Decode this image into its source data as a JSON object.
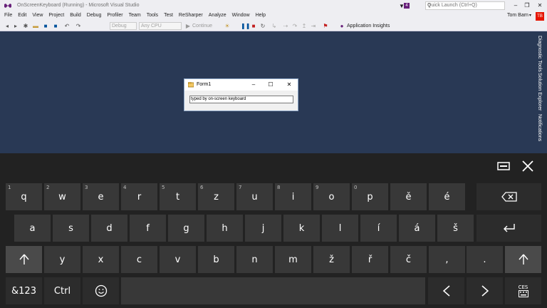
{
  "window": {
    "title": "OnScreenKeyboard (Running) - Microsoft Visual Studio",
    "notification_count": "4",
    "quick_launch_placeholder": "Quick Launch (Ctrl+Q)",
    "minimize": "–",
    "restore": "❐",
    "close": "✕"
  },
  "menu": [
    "File",
    "Edit",
    "View",
    "Project",
    "Build",
    "Debug",
    "Profiler",
    "Team",
    "Tools",
    "Test",
    "ReSharper",
    "Analyze",
    "Window",
    "Help"
  ],
  "user": {
    "name": "Tom Barn",
    "initials": "TB"
  },
  "toolbar": {
    "configuration": "Debug",
    "platform": "Any CPU",
    "continue_label": "Continue",
    "application_insights": "Application Insights"
  },
  "side_tabs": [
    "Diagnostic Tools",
    "Solution Explorer",
    "Notifications"
  ],
  "form1": {
    "title": "Form1",
    "textbox_value": "typed by on-screen keyboard",
    "minimize": "–",
    "maximize": "☐",
    "close": "✕"
  },
  "keyboard": {
    "row1": [
      {
        "label": "q",
        "num": "1"
      },
      {
        "label": "w",
        "num": "2"
      },
      {
        "label": "e",
        "num": "3"
      },
      {
        "label": "r",
        "num": "4"
      },
      {
        "label": "t",
        "num": "5"
      },
      {
        "label": "z",
        "num": "6"
      },
      {
        "label": "u",
        "num": "7"
      },
      {
        "label": "i",
        "num": "8"
      },
      {
        "label": "o",
        "num": "9"
      },
      {
        "label": "p",
        "num": "0"
      },
      {
        "label": "ě",
        "num": ""
      },
      {
        "label": "é",
        "num": ""
      }
    ],
    "row2": [
      "a",
      "s",
      "d",
      "f",
      "g",
      "h",
      "j",
      "k",
      "l",
      "í",
      "á",
      "š"
    ],
    "row3": [
      "y",
      "x",
      "c",
      "v",
      "b",
      "n",
      "m",
      "ž",
      "ř",
      "č",
      ",",
      "."
    ],
    "symbols_label": "&123",
    "ctrl_label": "Ctrl",
    "language_label": "CES",
    "icons": [
      "keyboard-layout-icon",
      "close-icon",
      "backspace-icon",
      "enter-icon",
      "shift-icon",
      "emoji-icon",
      "left-arrow-icon",
      "right-arrow-icon",
      "keyboard-icon"
    ]
  },
  "colors": {
    "editor_bg": "#293955",
    "keyboard_bg": "#222222",
    "key_bg": "#383838",
    "avatar_bg": "#e51400",
    "notification_badge": "#68217a"
  }
}
